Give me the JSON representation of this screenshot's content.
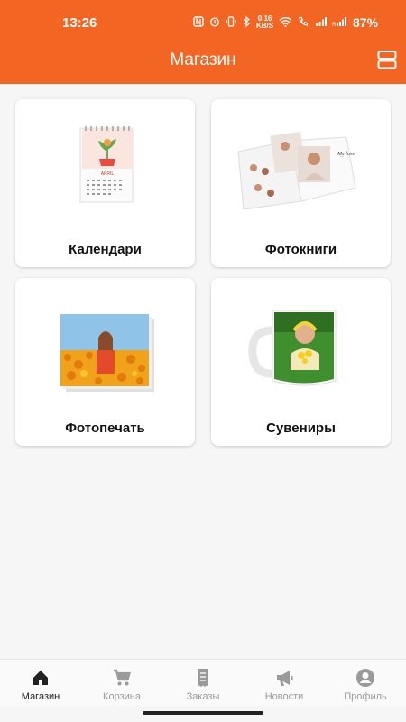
{
  "status_bar": {
    "time": "13:26",
    "speed_top": "0.16",
    "speed_bottom": "KB/S",
    "battery": "87%"
  },
  "header": {
    "title": "Магазин",
    "bg_color": "#f26522"
  },
  "categories": [
    {
      "label": "Календари",
      "icon": "calendar-image"
    },
    {
      "label": "Фотокниги",
      "icon": "photobook-image"
    },
    {
      "label": "Фотопечать",
      "icon": "photo-print-image"
    },
    {
      "label": "Сувениры",
      "icon": "mug-image"
    }
  ],
  "calendar_month": "APRIL",
  "photobook_caption": "My love",
  "nav": {
    "items": [
      {
        "label": "Магазин",
        "icon": "home-icon",
        "active": true
      },
      {
        "label": "Корзина",
        "icon": "cart-icon",
        "active": false
      },
      {
        "label": "Заказы",
        "icon": "receipt-icon",
        "active": false
      },
      {
        "label": "Новости",
        "icon": "megaphone-icon",
        "active": false
      },
      {
        "label": "Профиль",
        "icon": "user-icon",
        "active": false
      }
    ]
  }
}
